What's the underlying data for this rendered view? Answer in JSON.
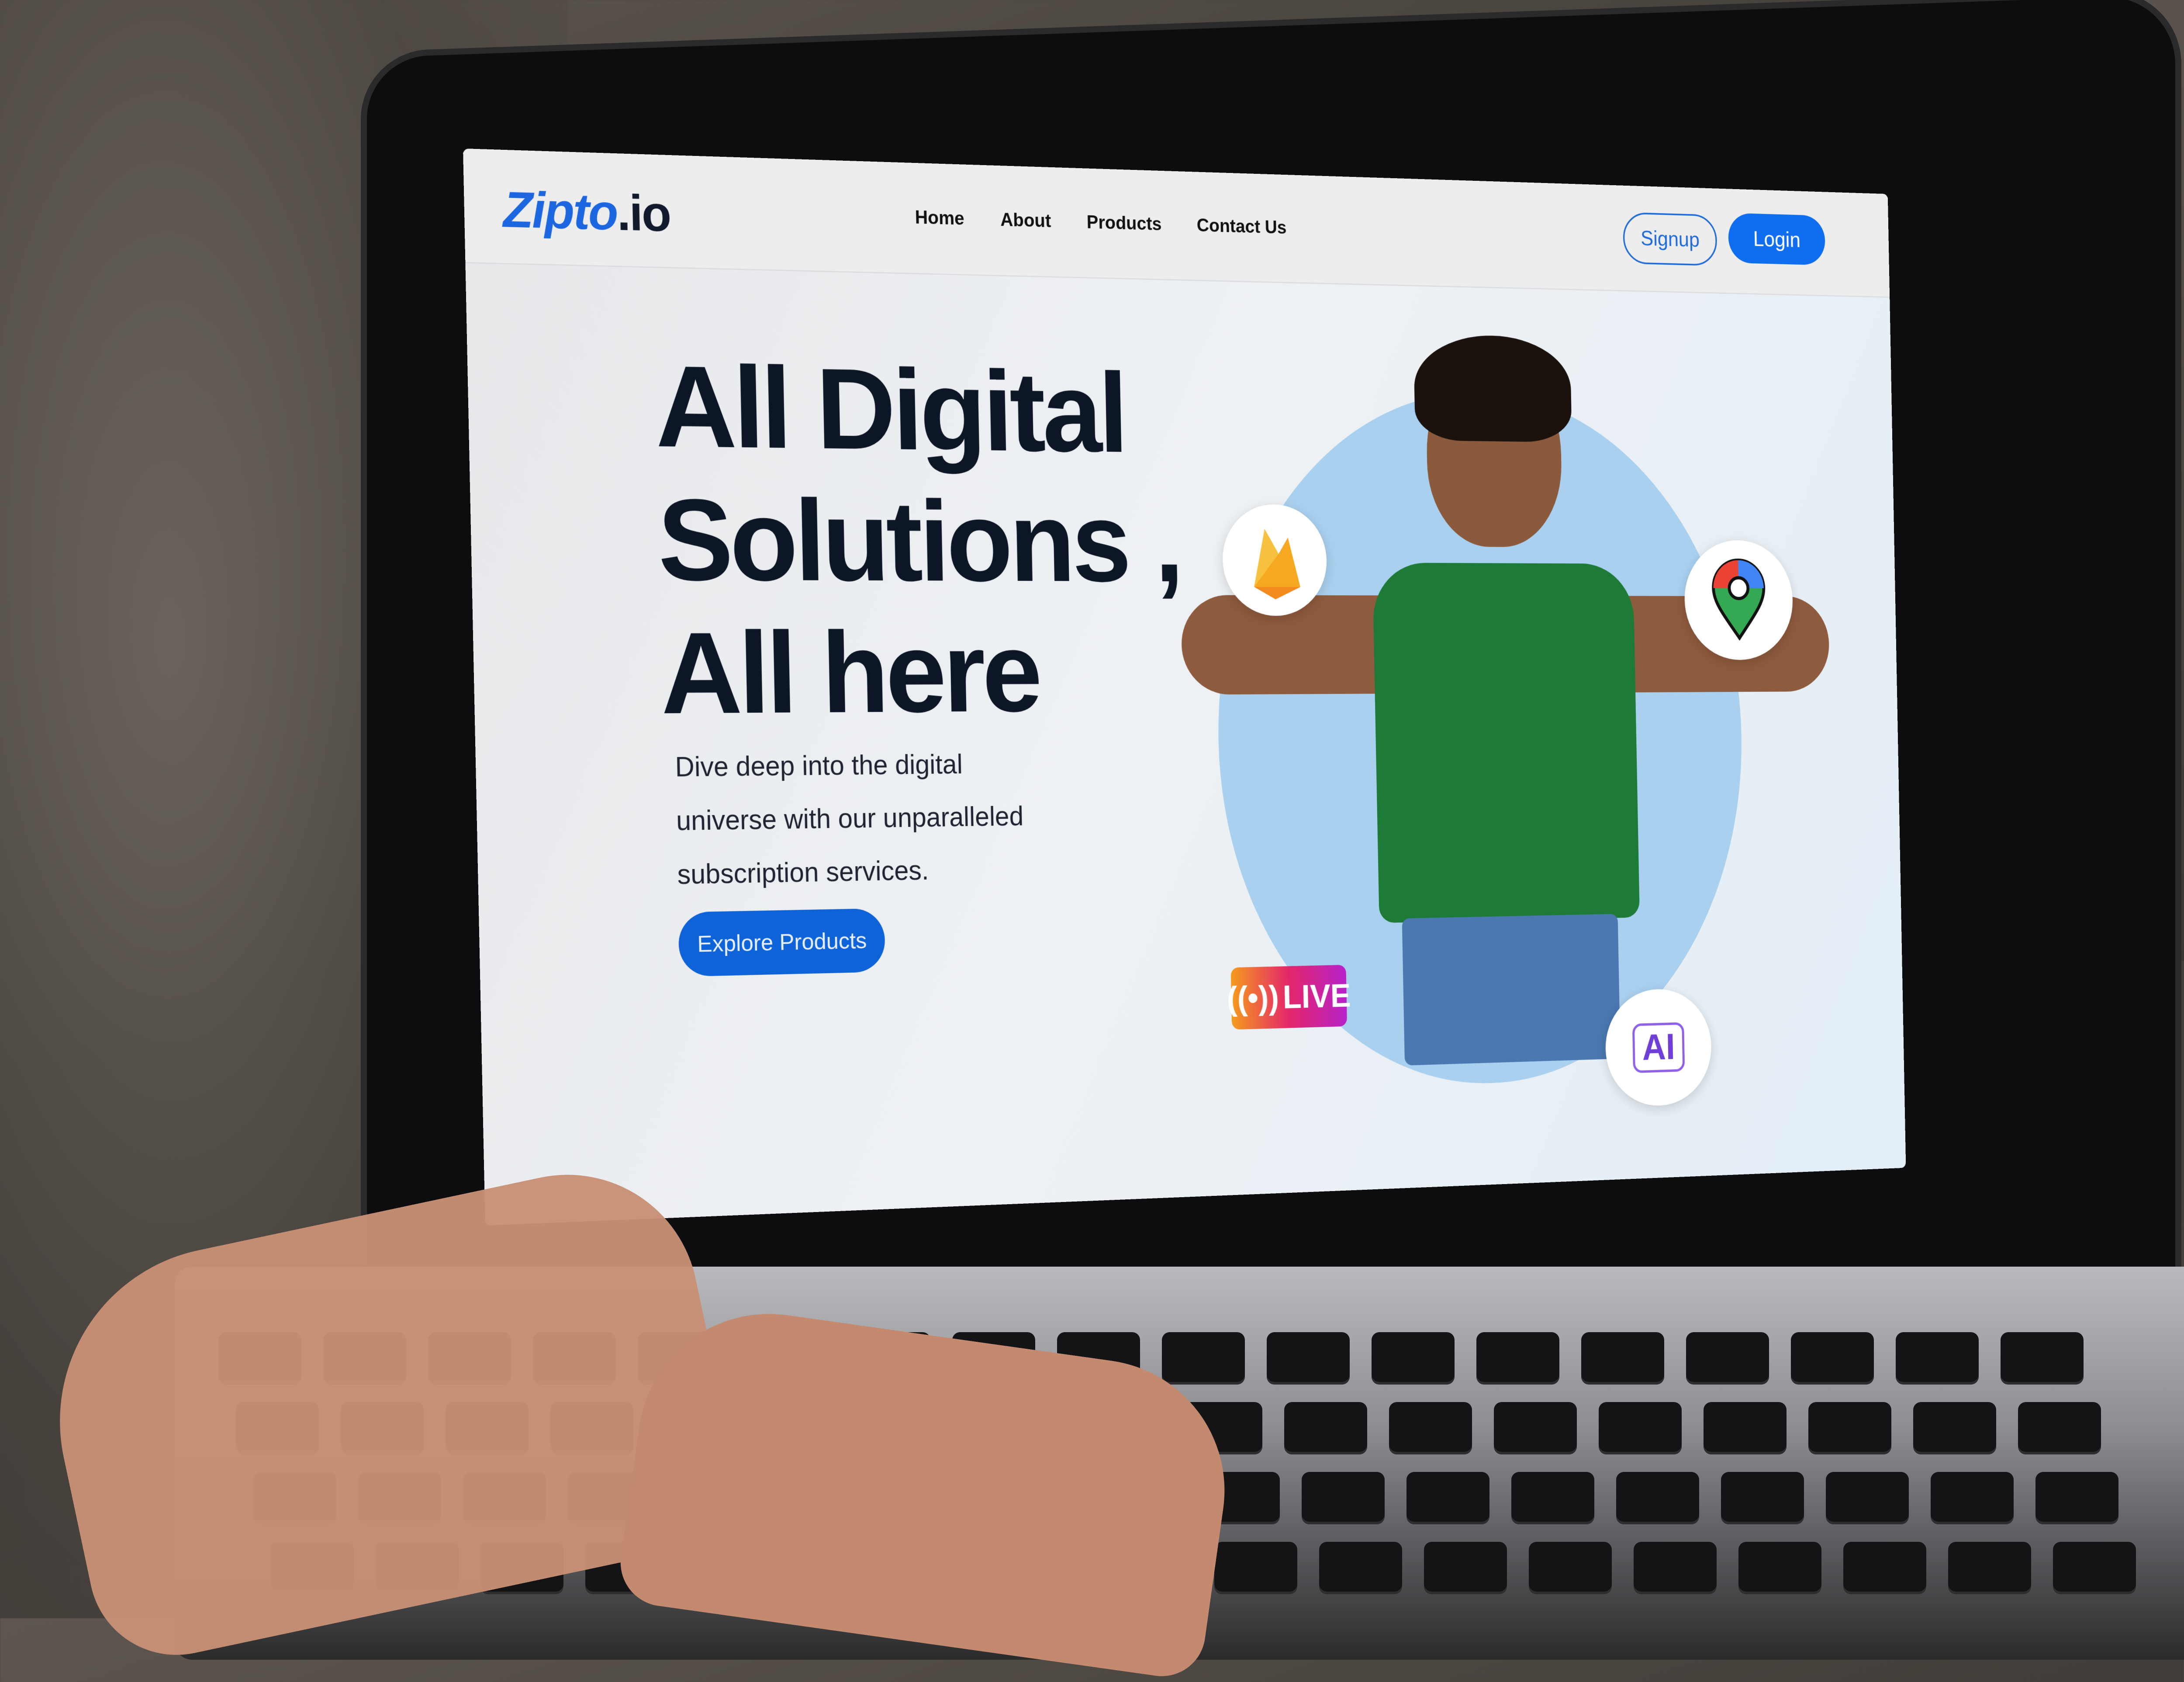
{
  "navbar": {
    "logo_main": "Zipto",
    "logo_suffix": ".io",
    "links": [
      "Home",
      "About",
      "Products",
      "Contact Us"
    ],
    "signup_label": "Signup",
    "login_label": "Login"
  },
  "hero": {
    "title_line1": "All Digital",
    "title_line2": "Solutions ,",
    "title_line3": "All here",
    "subtitle": "Dive deep into the digital universe with our unparalleled subscription services.",
    "cta_label": "Explore Products"
  },
  "badges": {
    "live_label": "LIVE",
    "ai_label": "AI",
    "fire_icon": "firebase-icon",
    "map_icon": "map-pin-icon"
  },
  "colors": {
    "accent_blue": "#0f6ef0",
    "headline": "#0c1626",
    "circle": "#a9d0ef",
    "shirt": "#1e7a37"
  }
}
